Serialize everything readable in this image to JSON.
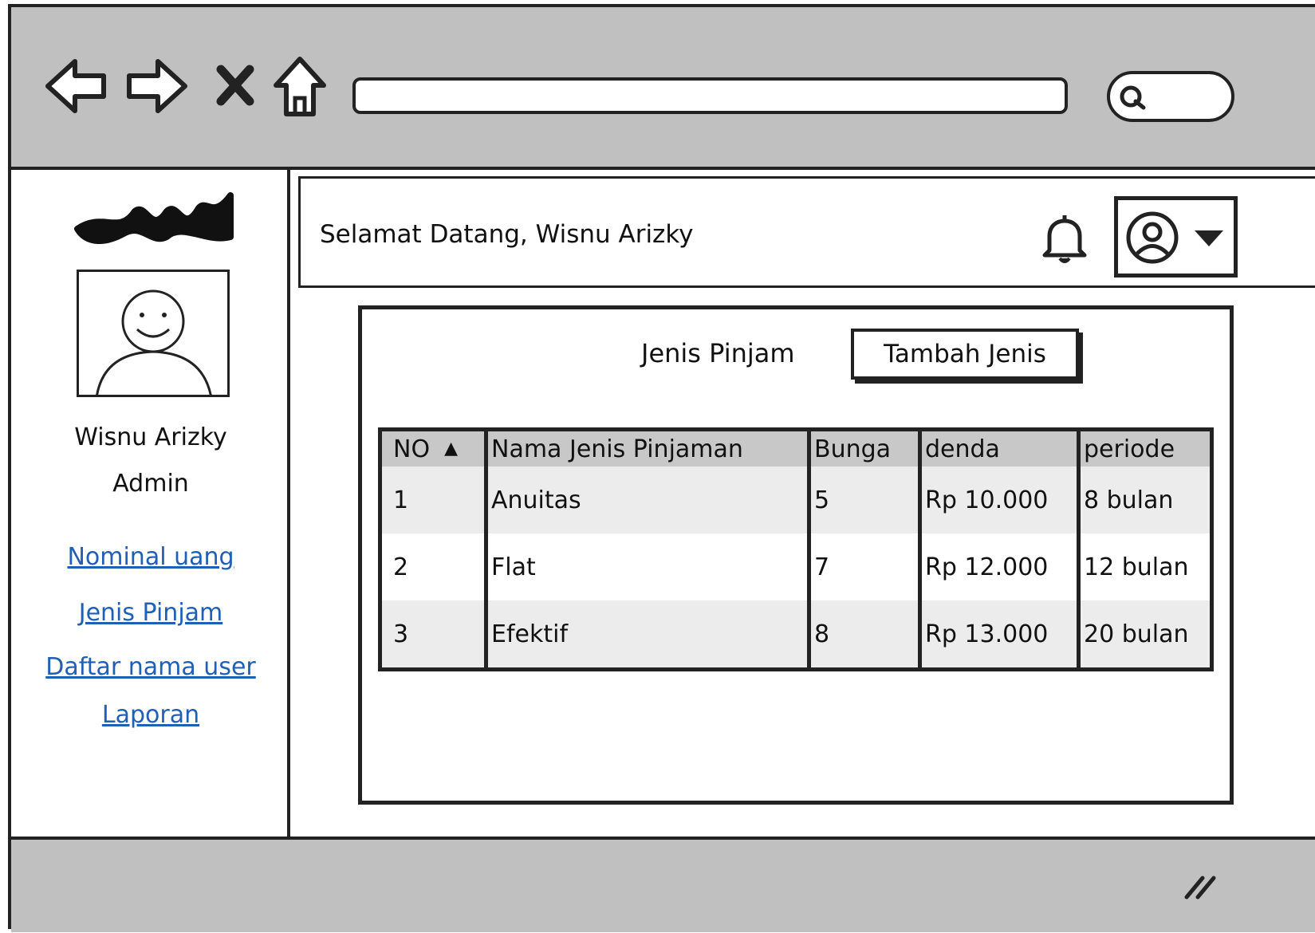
{
  "header": {
    "welcome": "Selamat Datang, Wisnu Arizky"
  },
  "sidebar": {
    "user_name": "Wisnu Arizky",
    "role": "Admin",
    "links": [
      "Nominal uang",
      "Jenis Pinjam",
      "Daftar nama user",
      "Laporan"
    ]
  },
  "panel": {
    "title": "Jenis Pinjam",
    "add_button": "Tambah Jenis"
  },
  "table": {
    "columns": [
      "NO",
      "Nama Jenis Pinjaman",
      "Bunga",
      "denda",
      "periode"
    ],
    "sort_column": "NO",
    "rows": [
      [
        "1",
        "Anuitas",
        "5",
        "Rp 10.000",
        "8 bulan"
      ],
      [
        "2",
        "Flat",
        "7",
        "Rp 12.000",
        "12 bulan"
      ],
      [
        "3",
        "Efektif",
        "8",
        "Rp 13.000",
        "20 bulan"
      ]
    ]
  },
  "icons": {
    "back": "back-arrow-icon",
    "forward": "forward-arrow-icon",
    "stop": "close-icon",
    "home": "home-icon",
    "search": "search-icon",
    "notification": "bell-icon",
    "account": "user-circle-icon",
    "dropdown": "caret-down-icon"
  },
  "colors": {
    "chrome": "#c0c0c0",
    "link": "#1f5fb5",
    "header_row": "#c8c8c8",
    "striped_row": "#ececec"
  }
}
